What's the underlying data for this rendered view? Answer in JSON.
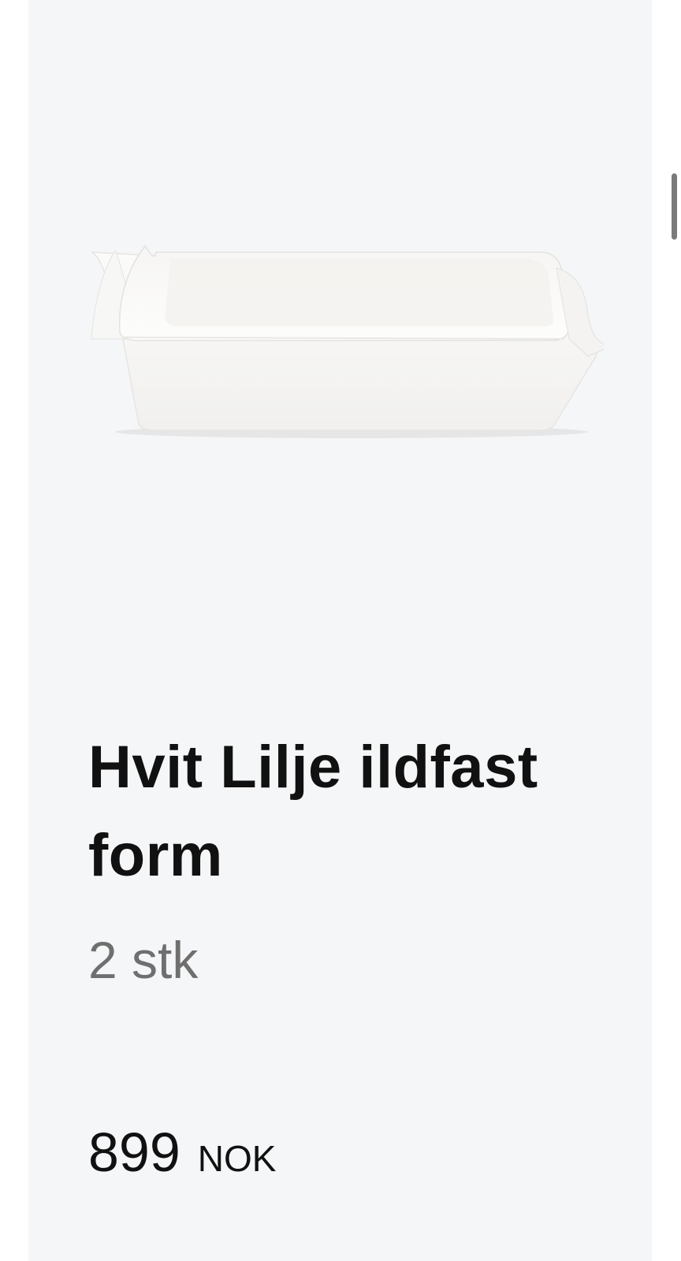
{
  "product": {
    "title": "Hvit Lilje ildfast form",
    "quantity": "2 stk",
    "price_amount": "899",
    "price_currency": "NOK"
  },
  "colors": {
    "card_background": "#f5f6f7",
    "title": "#111111",
    "quantity": "#6f6f6f"
  }
}
